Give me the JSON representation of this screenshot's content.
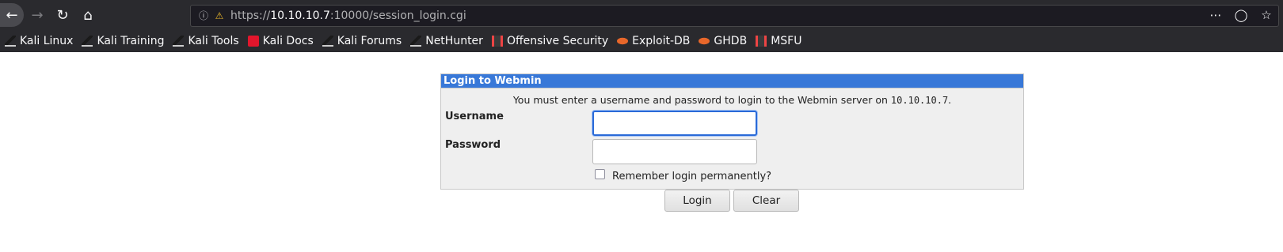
{
  "browser": {
    "url_scheme": "https://",
    "url_host": "10.10.10.7",
    "url_rest": ":10000/session_login.cgi",
    "nav_icons": [
      "back-arrow-icon",
      "forward-arrow-icon",
      "reload-icon",
      "home-icon"
    ],
    "url_right_icons": [
      "more-icon",
      "pocket-icon",
      "bookmark-star-icon"
    ],
    "bookmarks": [
      {
        "label": "Kali Linux",
        "icon": "kali-dragon-icon"
      },
      {
        "label": "Kali Training",
        "icon": "kali-dragon-icon"
      },
      {
        "label": "Kali Tools",
        "icon": "kali-dragon-icon"
      },
      {
        "label": "Kali Docs",
        "icon": "kali-docs-icon"
      },
      {
        "label": "Kali Forums",
        "icon": "kali-dragon-icon"
      },
      {
        "label": "NetHunter",
        "icon": "kali-dragon-icon"
      },
      {
        "label": "Offensive Security",
        "icon": "offsec-icon"
      },
      {
        "label": "Exploit-DB",
        "icon": "exploit-db-icon"
      },
      {
        "label": "GHDB",
        "icon": "exploit-db-icon"
      },
      {
        "label": "MSFU",
        "icon": "offsec-icon"
      }
    ]
  },
  "login": {
    "header": "Login to Webmin",
    "message": "You must enter a username and password to login to the Webmin server on",
    "message_ip": "10.10.10.7",
    "message_end": ".",
    "username_label": "Username",
    "password_label": "Password",
    "username_value": "",
    "password_value": "",
    "remember_label": "Remember login permanently?",
    "remember_checked": false,
    "login_button": "Login",
    "clear_button": "Clear"
  },
  "colors": {
    "chrome_bg": "#2a2a2e",
    "header_blue": "#3878d8",
    "panel_bg": "#efefef"
  }
}
